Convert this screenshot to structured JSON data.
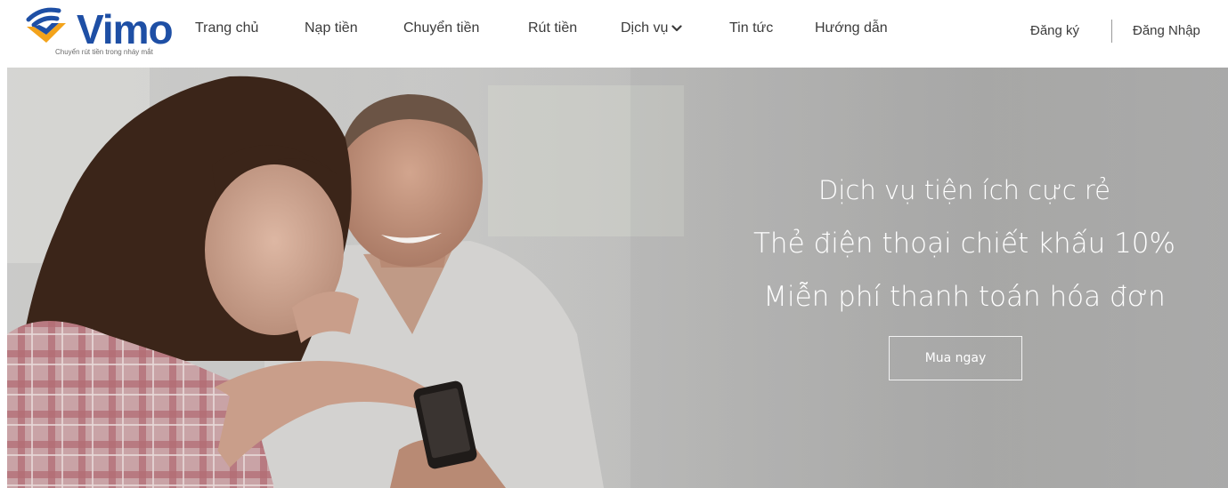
{
  "brand": {
    "name": "Vimo",
    "tagline": "Chuyển rút tiền trong nháy mắt",
    "colors": {
      "primary": "#1e4fa5",
      "accent": "#f3a31b"
    }
  },
  "nav": {
    "items": [
      {
        "label": "Trang chủ"
      },
      {
        "label": "Nạp tiền"
      },
      {
        "label": "Chuyển tiền"
      },
      {
        "label": "Rút tiền"
      },
      {
        "label": "Dịch vụ",
        "icon": "chevron-down-icon"
      },
      {
        "label": "Tin tức"
      },
      {
        "label": "Hướng dẫn"
      }
    ]
  },
  "auth": {
    "register": "Đăng ký",
    "login": "Đăng Nhập"
  },
  "hero": {
    "lines": [
      "Dịch vụ tiện ích cực rẻ",
      "Thẻ điện thoại chiết khấu 10%",
      "Miễn phí thanh toán hóa đơn"
    ],
    "cta": "Mua ngay"
  }
}
